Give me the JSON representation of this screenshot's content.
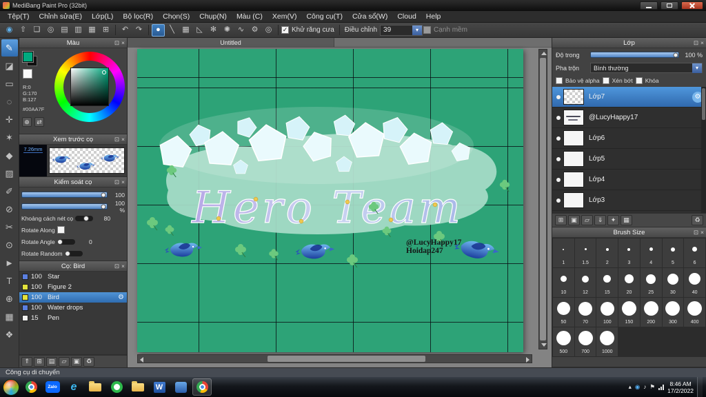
{
  "window": {
    "title": "MediBang Paint Pro (32bit)"
  },
  "menubar": {
    "items": [
      "Tệp(T)",
      "Chỉnh sửa(E)",
      "Lớp(L)",
      "Bộ lọc(R)",
      "Chọn(S)",
      "Chụp(N)",
      "Màu (C)",
      "Xem(V)",
      "Công cụ(T)",
      "Cửa sổ(W)",
      "Cloud",
      "Help"
    ]
  },
  "toolbar": {
    "antialias_label": "Khử răng cưa",
    "adjust_label": "Điều chỉnh",
    "adjust_value": "39",
    "soft_edge_label": "Cạnh mềm"
  },
  "icons": {
    "close": "×",
    "popout": "⊡",
    "undo": "↶",
    "redo": "↷",
    "gear": "⚙",
    "check": "✓",
    "dropdown_arrow": "▾",
    "toolbar_main": [
      "◉",
      "⇧",
      "❏",
      "◎",
      "▤",
      "▥",
      "▦",
      "⊞"
    ],
    "tool_options": [
      "●",
      "╲",
      "▦",
      "◺",
      "✻",
      "✺",
      "∿",
      "⚙",
      "◎"
    ],
    "toolstrip": [
      "✎",
      "◪",
      "▭",
      "◌",
      "✛",
      "✶",
      "◆",
      "▨",
      "✐",
      "⊘",
      "✂",
      "⊙",
      "►",
      "T",
      "⊕",
      "▦",
      "❖"
    ],
    "layer_buttons": [
      "⊞",
      "▣",
      "▱",
      "⇓",
      "✦",
      "▦"
    ],
    "trash": "♻",
    "left_bottom": [
      "⇑",
      "⊞",
      "▤",
      "▱",
      "▣",
      "♻"
    ],
    "swap": "⇄",
    "globe": "⊕",
    "ie": "e",
    "word": "W",
    "tray": [
      "▴",
      "◉",
      "♪",
      "⚑"
    ]
  },
  "panels": {
    "color": {
      "title": "Màu",
      "r": "R:0",
      "g": "G:170",
      "b": "B:127",
      "hex": "#00AA7F"
    },
    "preview": {
      "title": "Xem trước cọ",
      "size": "7.26mm"
    },
    "control": {
      "title": "Kiểm soát cọ",
      "value1": "100",
      "value2": "100 %",
      "spacing_label": "Khoảng cách nét cọ",
      "spacing_value": "80",
      "rotate_along_label": "Rotate Along",
      "rotate_angle_label": "Rotate Angle",
      "rotate_angle_value": "0",
      "rotate_random_label": "Rotate Random"
    },
    "brushes": {
      "title": "Cọ: Bird",
      "items": [
        {
          "num": "100",
          "name": "Star",
          "swatch": "background:#5b7fe0"
        },
        {
          "num": "100",
          "name": "Figure 2",
          "swatch": "background:#e3e23c"
        },
        {
          "num": "100",
          "name": "Bird",
          "swatch": "background:#e3e23c"
        },
        {
          "num": "100",
          "name": "Water drops",
          "swatch": "background:#5b7fe0"
        },
        {
          "num": "15",
          "name": "Pen",
          "swatch": "background:#f2f2f2"
        }
      ]
    },
    "layers": {
      "title": "Lớp",
      "opacity_label": "Độ trong",
      "opacity_value": "100 %",
      "blend_label": "Pha trộn",
      "blend_value": "Bình thường",
      "check1": "Bảo vệ alpha",
      "check2": "Xén bớt",
      "check3": "Khóa",
      "items": [
        "Lớp7",
        "@LucyHappy17",
        "Lớp6",
        "Lớp5",
        "Lớp4",
        "Lớp3"
      ]
    },
    "brush_size": {
      "title": "Brush Size",
      "sizes": [
        "1",
        "1.5",
        "2",
        "3",
        "4",
        "5",
        "6",
        "10",
        "12",
        "15",
        "20",
        "25",
        "30",
        "40",
        "50",
        "70",
        "100",
        "150",
        "200",
        "300",
        "400",
        "500",
        "700",
        "1000"
      ]
    }
  },
  "canvas": {
    "tab": "Untitled",
    "art_text": "Hero Team",
    "watermark1": "@LucyHappy17",
    "watermark2": "Hoidap247"
  },
  "statusbar": {
    "text": "Công cụ di chuyển"
  },
  "taskbar": {
    "zalo": "Zalo",
    "time": "8:46 AM",
    "date": "17/2/2022"
  }
}
